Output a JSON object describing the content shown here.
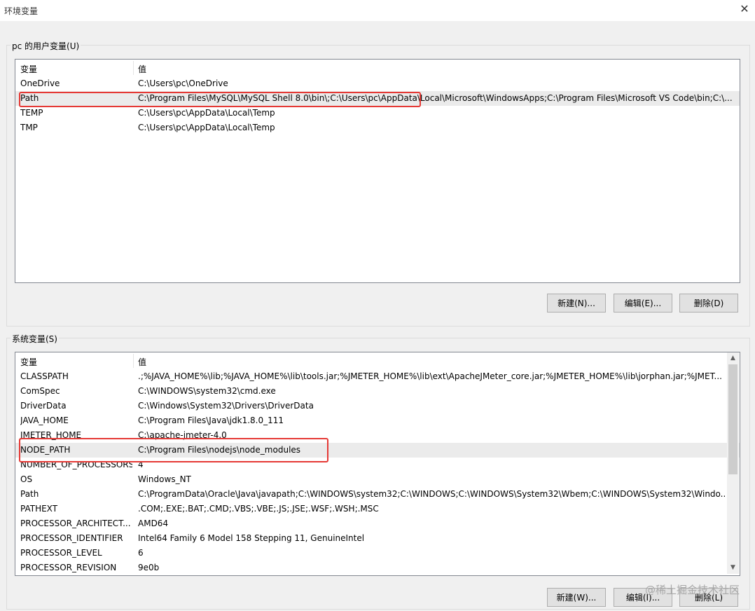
{
  "window": {
    "title": "环境变量",
    "close_glyph": "✕"
  },
  "user_section": {
    "label": "pc 的用户变量(U)",
    "columns": [
      "变量",
      "值"
    ],
    "rows": [
      {
        "name": "OneDrive",
        "value": "C:\\Users\\pc\\OneDrive"
      },
      {
        "name": "Path",
        "value": "C:\\Program Files\\MySQL\\MySQL Shell 8.0\\bin\\;C:\\Users\\pc\\AppData\\Local\\Microsoft\\WindowsApps;C:\\Program Files\\Microsoft VS Code\\bin;C:\\..."
      },
      {
        "name": "TEMP",
        "value": "C:\\Users\\pc\\AppData\\Local\\Temp"
      },
      {
        "name": "TMP",
        "value": "C:\\Users\\pc\\AppData\\Local\\Temp"
      }
    ],
    "buttons": {
      "new": "新建(N)...",
      "edit": "编辑(E)...",
      "delete": "删除(D)"
    }
  },
  "system_section": {
    "label": "系统变量(S)",
    "columns": [
      "变量",
      "值"
    ],
    "rows": [
      {
        "name": "CLASSPATH",
        "value": ".;%JAVA_HOME%\\lib;%JAVA_HOME%\\lib\\tools.jar;%JMETER_HOME%\\lib\\ext\\ApacheJMeter_core.jar;%JMETER_HOME%\\lib\\jorphan.jar;%JMET..."
      },
      {
        "name": "ComSpec",
        "value": "C:\\WINDOWS\\system32\\cmd.exe"
      },
      {
        "name": "DriverData",
        "value": "C:\\Windows\\System32\\Drivers\\DriverData"
      },
      {
        "name": "JAVA_HOME",
        "value": "C:\\Program Files\\Java\\jdk1.8.0_111"
      },
      {
        "name": "JMETER_HOME",
        "value": "C:\\apache-jmeter-4.0"
      },
      {
        "name": "NODE_PATH",
        "value": "C:\\Program Files\\nodejs\\node_modules"
      },
      {
        "name": "NUMBER_OF_PROCESSORS",
        "value": "4"
      },
      {
        "name": "OS",
        "value": "Windows_NT"
      },
      {
        "name": "Path",
        "value": "C:\\ProgramData\\Oracle\\Java\\javapath;C:\\WINDOWS\\system32;C:\\WINDOWS;C:\\WINDOWS\\System32\\Wbem;C:\\WINDOWS\\System32\\Windo..."
      },
      {
        "name": "PATHEXT",
        "value": ".COM;.EXE;.BAT;.CMD;.VBS;.VBE;.JS;.JSE;.WSF;.WSH;.MSC"
      },
      {
        "name": "PROCESSOR_ARCHITECT...",
        "value": "AMD64"
      },
      {
        "name": "PROCESSOR_IDENTIFIER",
        "value": "Intel64 Family 6 Model 158 Stepping 11, GenuineIntel"
      },
      {
        "name": "PROCESSOR_LEVEL",
        "value": "6"
      },
      {
        "name": "PROCESSOR_REVISION",
        "value": "9e0b"
      }
    ],
    "buttons": {
      "new": "新建(W)...",
      "edit": "编辑(I)...",
      "delete": "删除(L)"
    },
    "scroll_up_glyph": "▲",
    "scroll_down_glyph": "▼"
  },
  "watermark": "@稀土掘金技术社区",
  "colors": {
    "highlight": "#e53935",
    "selected_row": "#ebebeb",
    "window_bg": "#f0f0f0"
  }
}
